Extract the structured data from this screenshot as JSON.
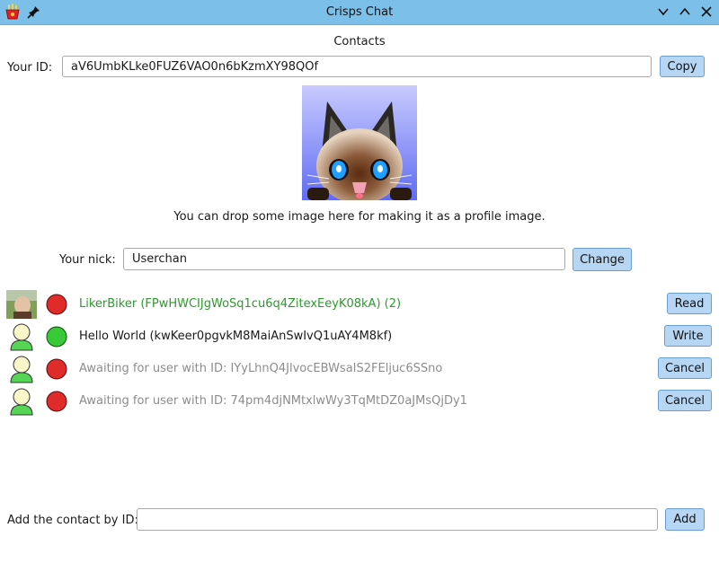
{
  "window": {
    "title": "Crisps Chat"
  },
  "header": {
    "contacts_title": "Contacts"
  },
  "id_section": {
    "label": "Your ID:",
    "value": "aV6UmbKLke0FUZ6VAO0n6bKzmXY98QOf",
    "copy_label": "Copy"
  },
  "profile": {
    "hint": "You can drop some image here for making it as a profile image."
  },
  "nick_section": {
    "label": "Your nick:",
    "value": "Userchan",
    "change_label": "Change"
  },
  "contacts": [
    {
      "avatar": "photo-avatar",
      "status": "offline",
      "status_color": "#e02b2b",
      "text": "LikerBiker (FPwHWCIJgWoSq1cu6q4ZitexEeyK08kA) (2)",
      "text_color": "#2c9a2c",
      "button": "Read"
    },
    {
      "avatar": "user-avatar",
      "status": "online",
      "status_color": "#38c838",
      "text": "Hello World (kwKeer0pgvkM8MaiAnSwIvQ1uAY4M8kf)",
      "text_color": "#1a1a1a",
      "button": "Write"
    },
    {
      "avatar": "user-avatar",
      "status": "offline",
      "status_color": "#e02b2b",
      "text": "Awaiting for user with ID: IYyLhnQ4JlvocEBWsaIS2FEljuc6SSno",
      "text_color": "#8c8c8c",
      "button": "Cancel"
    },
    {
      "avatar": "user-avatar",
      "status": "offline",
      "status_color": "#e02b2b",
      "text": "Awaiting for user with ID: 74pm4djNMtxlwWy3TqMtDZ0aJMsQjDy1",
      "text_color": "#8c8c8c",
      "button": "Cancel"
    }
  ],
  "add_section": {
    "label": "Add the contact by ID:",
    "value": "",
    "add_label": "Add"
  },
  "colors": {
    "titlebar": "#7cbfe8",
    "button": "#b7d6f4",
    "online": "#38c838",
    "offline": "#e02b2b"
  }
}
